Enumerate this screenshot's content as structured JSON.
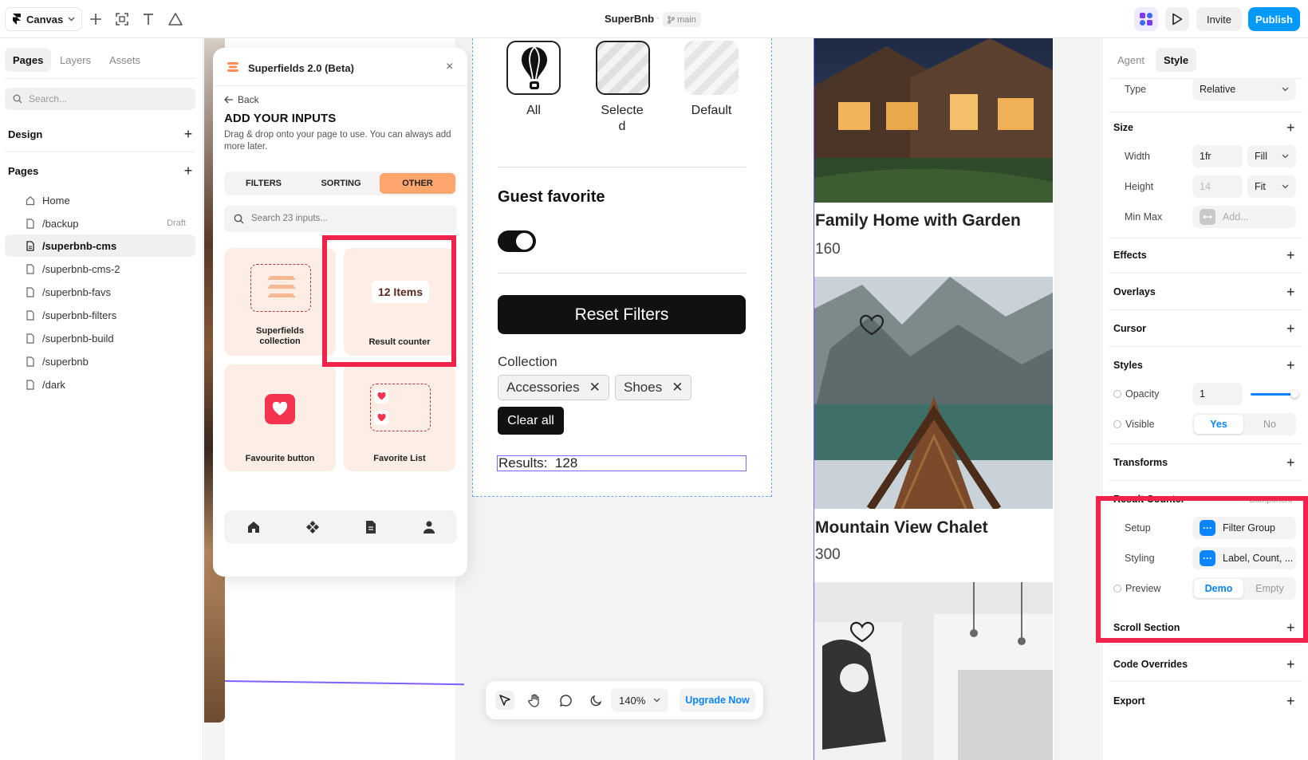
{
  "topbar": {
    "canvas_label": "Canvas",
    "project_title": "SuperBnb",
    "separator": "·",
    "branch": "main",
    "invite": "Invite",
    "publish": "Publish"
  },
  "left": {
    "tabs": [
      "Pages",
      "Layers",
      "Assets"
    ],
    "search_placeholder": "Search...",
    "design_label": "Design",
    "pages_label": "Pages",
    "pages": [
      {
        "name": "Home",
        "badge": ""
      },
      {
        "name": "/backup",
        "badge": "Draft"
      },
      {
        "name": "/superbnb-cms",
        "badge": ""
      },
      {
        "name": "/superbnb-cms-2",
        "badge": ""
      },
      {
        "name": "/superbnb-favs",
        "badge": ""
      },
      {
        "name": "/superbnb-filters",
        "badge": ""
      },
      {
        "name": "/superbnb-build",
        "badge": ""
      },
      {
        "name": "/superbnb",
        "badge": ""
      },
      {
        "name": "/dark",
        "badge": ""
      }
    ],
    "active_page": "/superbnb-cms"
  },
  "plugin": {
    "title": "Superfields 2.0 (Beta)",
    "close": "×",
    "back": "Back",
    "heading": "ADD YOUR INPUTS",
    "description": "Drag & drop onto your page to use. You can always add more later.",
    "tabs": [
      "FILTERS",
      "SORTING",
      "OTHER"
    ],
    "active_tab": "OTHER",
    "search_placeholder": "Search 23 inputs...",
    "cards": [
      {
        "label_line1": "Superfields",
        "label_line2": "collection"
      },
      {
        "label": "Result counter",
        "preview": "12 Items"
      },
      {
        "label": "Favourite button"
      },
      {
        "label": "Favorite List"
      }
    ],
    "accent_color": "#ffa66f"
  },
  "preview": {
    "card_labels": [
      "All",
      "Selecte",
      "d",
      "Default"
    ],
    "guest_favorite": "Guest favorite",
    "reset_filters": "Reset Filters",
    "collection_label": "Collection",
    "chips": [
      "Accessories",
      "Shoes"
    ],
    "chip_remove": "✕",
    "clear_all": "Clear all",
    "results_label": "Results:",
    "results_count": "128"
  },
  "listings": [
    {
      "title": "Family Home with Garden",
      "price": "160"
    },
    {
      "title": "Mountain View Chalet",
      "price": "300"
    }
  ],
  "toolbar": {
    "zoom": "140%",
    "upgrade": "Upgrade Now"
  },
  "right": {
    "tabs": [
      "Agent",
      "Style"
    ],
    "active_tab": "Style",
    "type_label": "Type",
    "type_value": "Relative",
    "size_label": "Size",
    "width_label": "Width",
    "width_value": "1fr",
    "width_mode": "Fill",
    "height_label": "Height",
    "height_value": "14",
    "height_mode": "Fit",
    "minmax_label": "Min Max",
    "minmax_placeholder": "Add...",
    "effects": "Effects",
    "overlays": "Overlays",
    "cursor": "Cursor",
    "styles": "Styles",
    "opacity_label": "Opacity",
    "opacity_value": "1",
    "visible_label": "Visible",
    "visible_yes": "Yes",
    "visible_no": "No",
    "transforms": "Transforms",
    "component_title": "Result Counter",
    "component_badge": "Component",
    "setup_label": "Setup",
    "setup_value": "Filter Group",
    "styling_label": "Styling",
    "styling_value": "Label, Count, ...",
    "preview_label": "Preview",
    "preview_demo": "Demo",
    "preview_empty": "Empty",
    "scroll_section": "Scroll Section",
    "code_overrides": "Code Overrides",
    "export": "Export",
    "accent_color": "#0a84ff",
    "highlight_color": "#f2234a"
  }
}
